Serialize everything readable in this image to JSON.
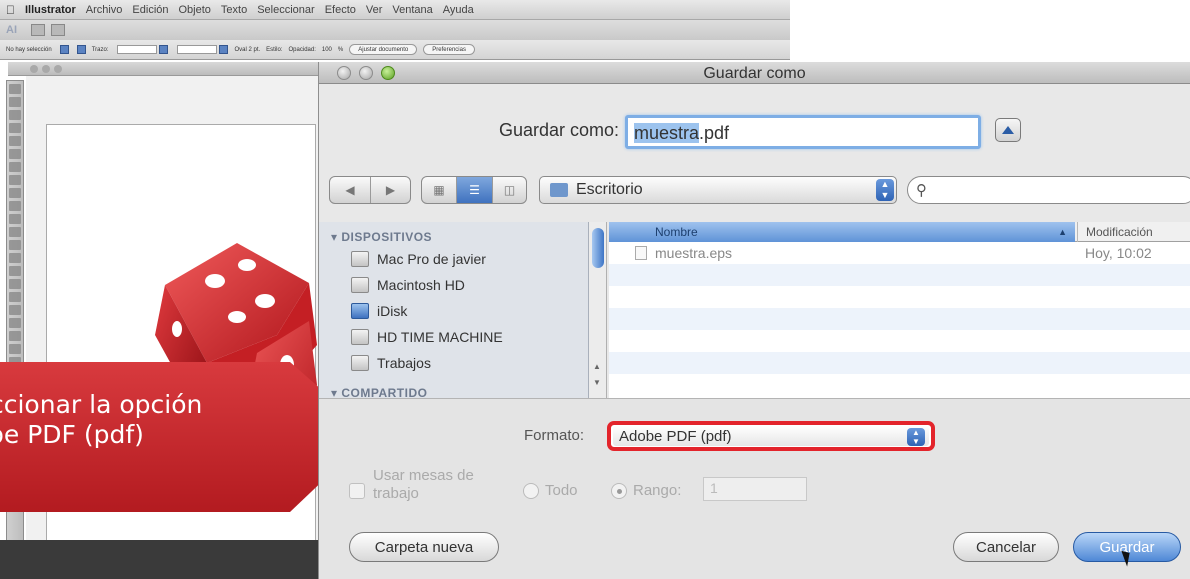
{
  "menubar": {
    "app_name": "Illustrator",
    "items": [
      "Archivo",
      "Edición",
      "Objeto",
      "Texto",
      "Seleccionar",
      "Efecto",
      "Ver",
      "Ventana",
      "Ayuda"
    ]
  },
  "app_toolbar": {
    "ai_badge": "AI"
  },
  "control_bar": {
    "no_selection": "No hay selección",
    "stroke_label": "Trazo:",
    "brush": "Oval 2 pt.",
    "style_label": "Estilo:",
    "opacity_label": "Opacidad:",
    "opacity_value": "100",
    "opacity_unit": "%",
    "fit_document": "Ajustar documento",
    "preferences": "Preferencias"
  },
  "callout": {
    "line1": "ccionar la opción",
    "line2": "be PDF (pdf)",
    "color": "#c8262b"
  },
  "dialog": {
    "title": "Guardar como",
    "save_as_label": "Guardar como:",
    "filename_selected": "muestra",
    "filename_ext": ".pdf",
    "location": "Escritorio",
    "search_placeholder": "",
    "sidebar": {
      "devices_header": "DISPOSITIVOS",
      "devices": [
        "Mac Pro de javier",
        "Macintosh HD",
        "iDisk",
        "HD TIME MACHINE",
        "Trabajos"
      ],
      "shared_header": "COMPARTIDO"
    },
    "columns": {
      "name": "Nombre",
      "modified": "Modificación"
    },
    "files": [
      {
        "name": "muestra.eps",
        "modified": "Hoy, 10:02"
      }
    ],
    "format_label": "Formato:",
    "format_value": "Adobe PDF (pdf)",
    "use_artboards_label": "Usar mesas de trabajo",
    "all_label": "Todo",
    "range_label": "Rango:",
    "range_value": "1",
    "new_folder": "Carpeta nueva",
    "cancel": "Cancelar",
    "save": "Guardar",
    "highlight_color": "#e3242b",
    "accent_color": "#3f72bf"
  },
  "icons": {
    "apple": "apple-icon",
    "search": "magnifier-icon",
    "folder": "folder-icon",
    "disk": "disk-icon",
    "file": "file-icon"
  }
}
